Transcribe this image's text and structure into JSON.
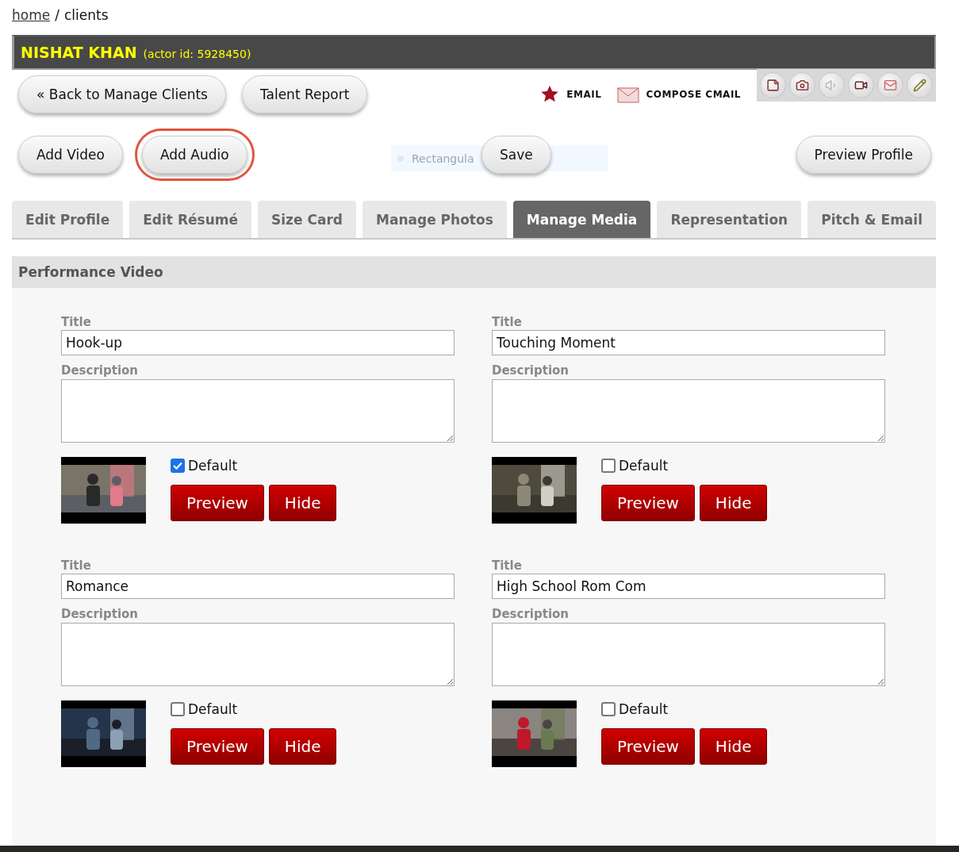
{
  "breadcrumb": {
    "link": "home",
    "separator": "/",
    "current": "clients"
  },
  "header": {
    "name": "NISHAT KHAN",
    "actor_id": "(actor id: 5928450)"
  },
  "nav_buttons": [
    "« Back to Manage Clients",
    "Talent Report"
  ],
  "quick_links": [
    {
      "kind": "star",
      "label": "EMAIL"
    },
    {
      "kind": "envelope",
      "label": "COMPOSE CMAIL"
    }
  ],
  "action_buttons": [
    {
      "label": "Add Video",
      "highlighted": false
    },
    {
      "label": "Add Audio",
      "highlighted": true
    }
  ],
  "snip_hint": "Rectangula",
  "save_button": "Save",
  "preview_profile_button": "Preview Profile",
  "tabs": [
    {
      "label": "Edit Profile",
      "selected": false
    },
    {
      "label": "Edit Résumé",
      "selected": false
    },
    {
      "label": "Size Card",
      "selected": false
    },
    {
      "label": "Manage Photos",
      "selected": false
    },
    {
      "label": "Manage Media",
      "selected": true
    },
    {
      "label": "Representation",
      "selected": false
    },
    {
      "label": "Pitch & Email",
      "selected": false
    }
  ],
  "section_title": "Performance Video",
  "videos": [
    {
      "title_label": "Title",
      "title": "Hook-up",
      "description_label": "Description",
      "default_label": "Default",
      "default_checked": true,
      "preview": "Preview",
      "hide": "Hide"
    },
    {
      "title_label": "Title",
      "title": "Touching Moment",
      "description_label": "Description",
      "default_label": "Default",
      "default_checked": false,
      "preview": "Preview",
      "hide": "Hide"
    },
    {
      "title_label": "Title",
      "title": "Romance",
      "description_label": "Description",
      "default_label": "Default",
      "default_checked": false,
      "preview": "Preview",
      "hide": "Hide"
    },
    {
      "title_label": "Title",
      "title": "High School Rom Com",
      "description_label": "Description",
      "default_label": "Default",
      "default_checked": false,
      "preview": "Preview",
      "hide": "Hide"
    }
  ]
}
